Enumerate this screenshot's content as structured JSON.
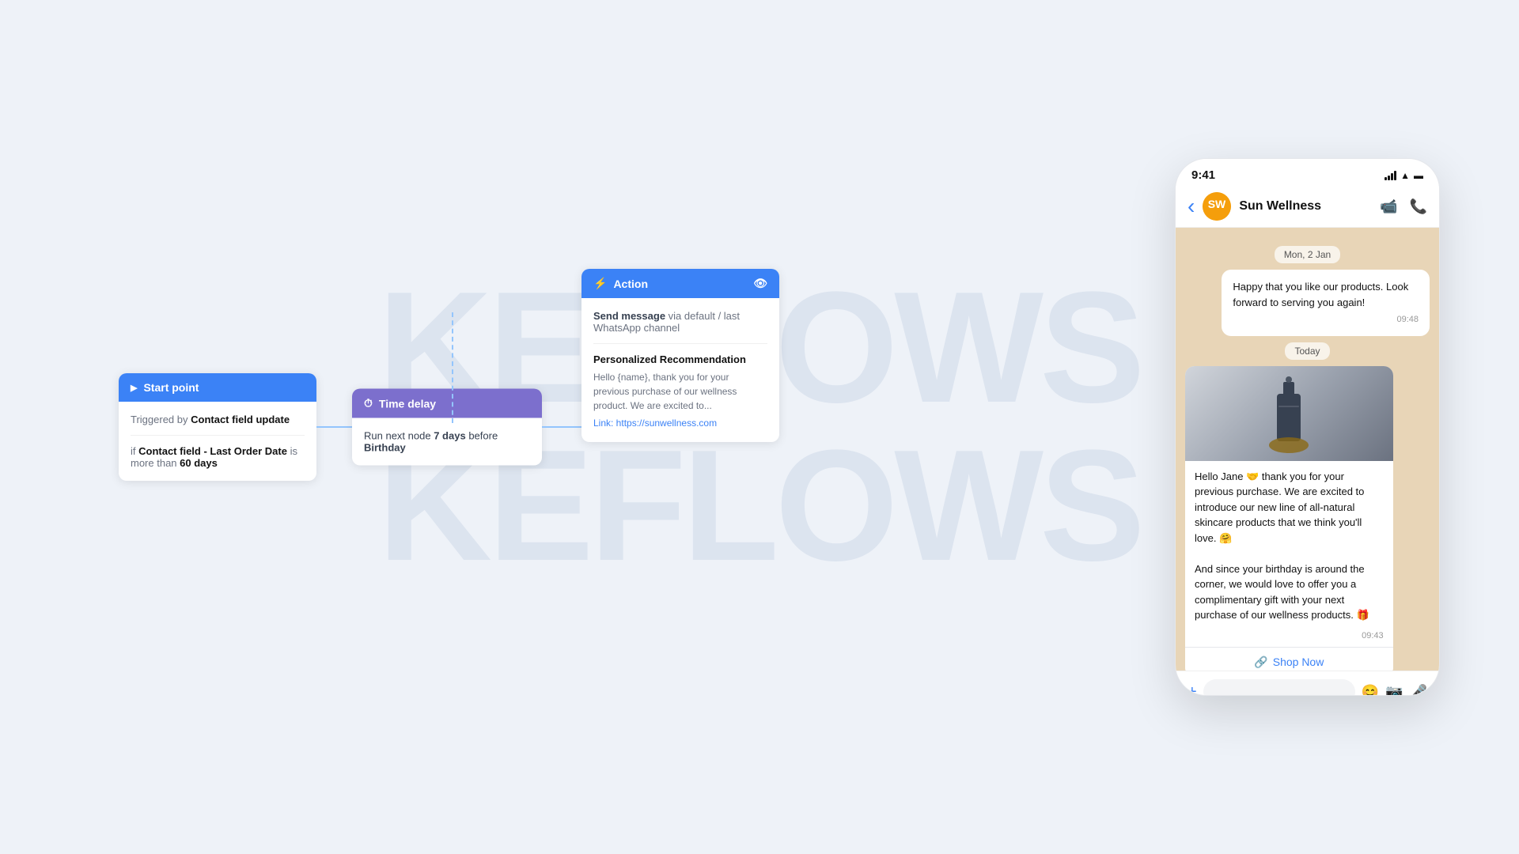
{
  "watermark": {
    "rows": [
      {
        "text": "KEFLOWS"
      },
      {
        "text": "KEFLOWS"
      }
    ]
  },
  "flow": {
    "start_node": {
      "header_label": "Start point",
      "trigger_prefix": "Triggered by",
      "trigger_value": "Contact field update",
      "condition_prefix": "if",
      "condition_field": "Contact field - Last Order Date",
      "condition_operator": "is more than",
      "condition_value": "60 days"
    },
    "time_delay_node": {
      "header_label": "Time delay",
      "body_prefix": "Run next node",
      "body_days": "7 days",
      "body_suffix": "before",
      "body_event": "Birthday"
    },
    "action_node": {
      "header_label": "Action",
      "send_message_label": "Send message",
      "send_message_via": "via",
      "send_message_channel": "default / last WhatsApp channel",
      "recommendation_title": "Personalized Recommendation",
      "recommendation_text": "Hello {name}, thank you for your previous purchase of our wellness product. We are excited to...",
      "recommendation_link": "Link: https://sunwellness.com"
    }
  },
  "phone": {
    "status_bar": {
      "time": "9:41",
      "signal": "signal",
      "wifi": "wifi",
      "battery": "battery"
    },
    "header": {
      "contact_name": "Sun Wellness",
      "back_label": "‹",
      "video_icon": "video-call",
      "phone_icon": "phone-call"
    },
    "chat": {
      "date_old": "Mon, 2 Jan",
      "message_old": "Happy that you like our products. Look forward to serving you again!",
      "time_old": "09:48",
      "date_today": "Today",
      "message_new_text": "Hello Jane 🤝 thank you for your previous purchase. We are excited to introduce our new line of all-natural skincare products that we think you'll love. 🤗\n\nAnd since your birthday is around the corner, we would love to offer you a complimentary gift with your next purchase of our wellness products. 🎁",
      "time_new": "09:43",
      "shop_now_label": "Shop Now"
    },
    "bottom_bar": {
      "plus_icon": "add",
      "sticker_icon": "sticker",
      "camera_icon": "camera",
      "mic_icon": "microphone"
    }
  }
}
